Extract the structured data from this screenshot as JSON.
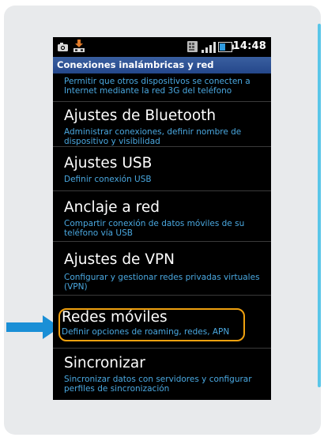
{
  "status_bar": {
    "time": "14:48",
    "left_icons": [
      "camera-icon",
      "usb-icon"
    ],
    "right_icons": [
      "sim-icon",
      "signal-icon",
      "battery-icon"
    ]
  },
  "header": {
    "title": "Conexiones inalámbricas y red"
  },
  "items": [
    {
      "title": "",
      "summary": "Permitir que otros dispositivos se conecten a Internet mediante la red 3G del teléfono"
    },
    {
      "title": "Ajustes de Bluetooth",
      "summary": "Administrar conexiones, definir nombre de dispositivo y visibilidad"
    },
    {
      "title": "Ajustes USB",
      "summary": "Definir conexión USB"
    },
    {
      "title": "Anclaje a red",
      "summary": "Compartir conexión de datos móviles de su teléfono vía USB"
    },
    {
      "title": "Ajustes de VPN",
      "summary": "Configurar y gestionar redes privadas virtuales (VPN)"
    },
    {
      "title": "Redes móviles",
      "summary": "Definir opciones de roaming, redes, APN"
    },
    {
      "title": "Sincronizar",
      "summary": "Sincronizar datos con servidores y configurar perfiles de sincronización"
    }
  ],
  "annotations": {
    "arrow_color": "#1a8fd6",
    "highlight_color": "#f0a10f"
  }
}
